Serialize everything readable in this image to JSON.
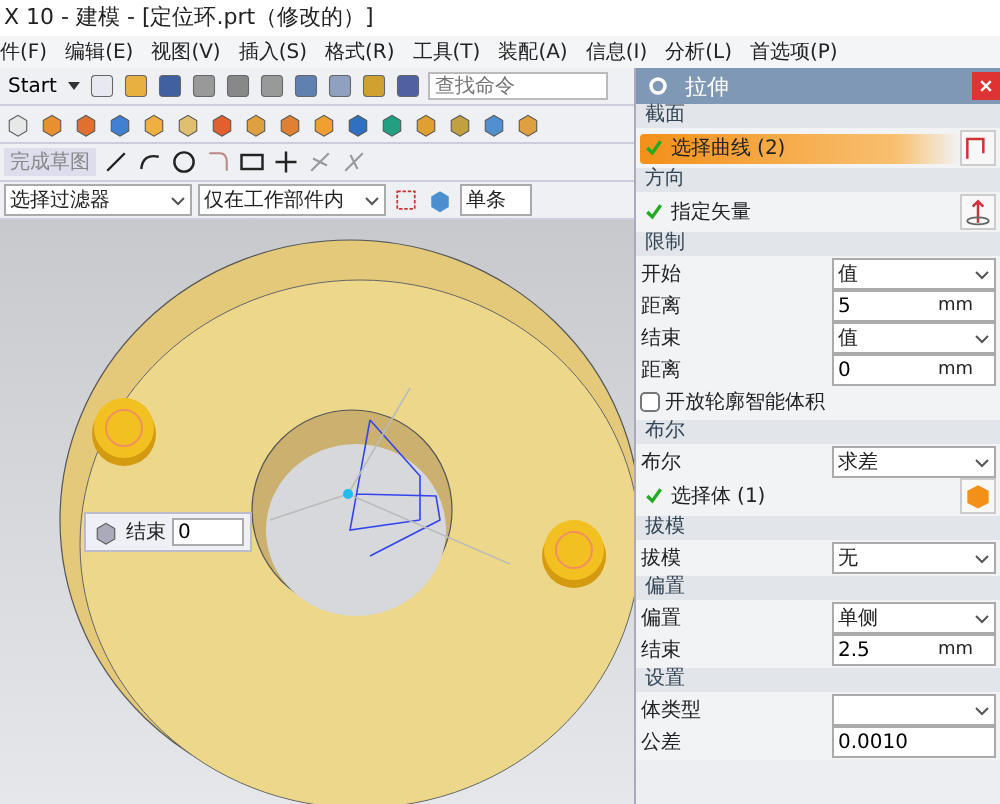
{
  "title": "X 10 - 建模 - [定位环.prt（修改的）]",
  "menu": [
    "件(F)",
    "编辑(E)",
    "视图(V)",
    "插入(S)",
    "格式(R)",
    "工具(T)",
    "装配(A)",
    "信息(I)",
    "分析(L)",
    "首选项(P)"
  ],
  "toolbar": {
    "start": "Start",
    "search_placeholder": "查找命令"
  },
  "sketch_toolbar": {
    "finish": "完成草图"
  },
  "selection_bar": {
    "filter": "选择过滤器",
    "scope": "仅在工作部件内",
    "mode": "单条"
  },
  "viewport": {
    "floating_input": {
      "label": "结束",
      "value": "0"
    }
  },
  "dialog": {
    "title": "拉伸",
    "sections": [
      {
        "title": "截面",
        "rows": [
          {
            "kind": "select",
            "label": "选择曲线 (2)",
            "active": true
          }
        ]
      },
      {
        "title": "方向",
        "rows": [
          {
            "kind": "vector",
            "label": "指定矢量",
            "active": false
          }
        ]
      },
      {
        "title": "限制",
        "rows": [
          {
            "kind": "dropdown",
            "label": "开始",
            "value": "值"
          },
          {
            "kind": "number",
            "label": "距离",
            "value": "5",
            "unit": "mm"
          },
          {
            "kind": "dropdown",
            "label": "结束",
            "value": "值"
          },
          {
            "kind": "number",
            "label": "距离",
            "value": "0",
            "unit": "mm"
          },
          {
            "kind": "checkbox",
            "label": "开放轮廓智能体积",
            "checked": false
          }
        ]
      },
      {
        "title": "布尔",
        "rows": [
          {
            "kind": "dropdown",
            "label": "布尔",
            "value": "求差"
          },
          {
            "kind": "body",
            "label": "选择体 (1)",
            "active": false
          }
        ]
      },
      {
        "title": "拔模",
        "rows": [
          {
            "kind": "dropdown",
            "label": "拔模",
            "value": "无"
          }
        ]
      },
      {
        "title": "偏置",
        "rows": [
          {
            "kind": "dropdown",
            "label": "偏置",
            "value": "单侧"
          },
          {
            "kind": "number",
            "label": "结束",
            "value": "2.5",
            "unit": "mm"
          }
        ]
      },
      {
        "title": "设置",
        "rows": [
          {
            "kind": "dropdown",
            "label": "体类型"
          },
          {
            "kind": "number",
            "label": "公差",
            "value": "0.0010"
          }
        ]
      }
    ]
  }
}
